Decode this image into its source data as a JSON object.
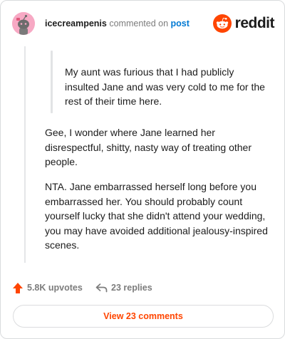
{
  "header": {
    "username": "icecreampenis",
    "action_text": "commented on",
    "post_link": "post",
    "brand": "reddit"
  },
  "comment": {
    "quote": "My aunt was furious that I had publicly insulted Jane and was very cold to me for the rest of their time here.",
    "paragraphs": [
      "Gee, I wonder where Jane learned her disrespectful, shitty, nasty way of treating other people.",
      "NTA. Jane embarrassed herself long before you embarrassed her. You should probably count yourself lucky that she didn't attend your wedding, you may have avoided additional jealousy-inspired scenes."
    ]
  },
  "footer": {
    "upvotes": "5.8K upvotes",
    "replies": "23 replies",
    "view_button": "View 23 comments"
  },
  "colors": {
    "accent": "#ff4500",
    "link": "#0079d3",
    "avatar_bg": "#f7a9c4"
  },
  "icons": {
    "avatar": "snoo-avatar-icon",
    "brand_logo": "reddit-logo-icon",
    "upvote": "upvote-arrow-icon",
    "replies": "reply-arrow-icon"
  }
}
